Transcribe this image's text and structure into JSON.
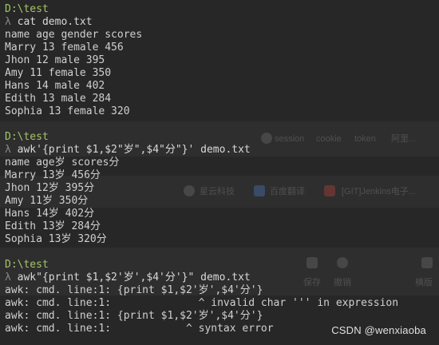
{
  "blocks": [
    {
      "prompt": "D:\\test",
      "lambda": "λ",
      "command": "cat demo.txt",
      "output": [
        "name age gender scores",
        "Marry 13 female 456",
        "Jhon 12 male 395",
        "Amy 11 female 350",
        "Hans 14 male 402",
        "Edith 13 male 284",
        "Sophia 13 female 320"
      ]
    },
    {
      "prompt": "D:\\test",
      "lambda": "λ",
      "command": "awk'{print $1,$2\"岁\",$4\"分\"}' demo.txt",
      "output": [
        "name age岁 scores分",
        "Marry 13岁 456分",
        "Jhon 12岁 395分",
        "Amy 11岁 350分",
        "Hans 14岁 402分",
        "Edith 13岁 284分",
        "Sophia 13岁 320分"
      ]
    },
    {
      "prompt": "D:\\test",
      "lambda": "λ",
      "command": "awk\"{print $1,$2'岁',$4'分'}\" demo.txt",
      "output": [
        "awk: cmd. line:1: {print $1,$2'岁',$4'分'}",
        "awk: cmd. line:1:              ^ invalid char ''' in expression",
        "awk: cmd. line:1: {print $1,$2'岁',$4'分'}",
        "awk: cmd. line:1:            ^ syntax error"
      ]
    }
  ],
  "background_ghost": {
    "row1": [
      "session",
      "cookie",
      "token",
      "阿里..."
    ],
    "row2": [
      "星云科技",
      "百度翻译",
      "[GIT]Jenkins电子..."
    ],
    "row3": [
      "保存",
      "撤销",
      "横版"
    ]
  },
  "watermark": "CSDN @wenxiaoba",
  "colors": {
    "background": "#272727",
    "prompt": "#a5c46a",
    "text": "#d8d8d8"
  }
}
